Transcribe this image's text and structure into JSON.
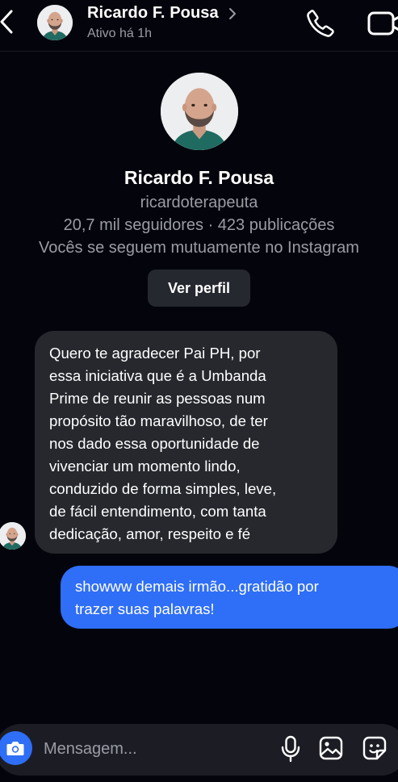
{
  "header": {
    "name": "Ricardo F. Pousa",
    "status": "Ativo há 1h",
    "icons": [
      "back-arrow-icon",
      "chevron-right-icon",
      "phone-icon",
      "video-camera-icon"
    ]
  },
  "profile": {
    "name": "Ricardo F. Pousa",
    "username": "ricardoterapeuta",
    "stats": "20,7 mil seguidores · 423 publicações",
    "mutual": "Vocês se seguem mutuamente no Instagram",
    "view_profile_label": "Ver perfil"
  },
  "messages": [
    {
      "direction": "incoming",
      "text": "Quero te agradecer Pai PH, por\nessa iniciativa que é a Umbanda\nPrime de reunir as pessoas num\npropósito tão maravilhoso, de ter\nnos dado essa oportunidade de\nvivenciar um momento lindo,\nconduzido de forma simples, leve,\nde fácil entendimento, com tanta\ndedicação, amor, respeito e fé"
    },
    {
      "direction": "outgoing",
      "text": "showww demais irmão...gratidão por\ntrazer suas palavras!"
    }
  ],
  "composer": {
    "placeholder": "Mensagem...",
    "icons": [
      "camera-icon",
      "microphone-icon",
      "gallery-icon",
      "sticker-icon"
    ]
  },
  "colors": {
    "background": "#04050c",
    "incoming_bubble": "#26282e",
    "outgoing_bubble": "#2f6ef6",
    "secondary_text": "#9a9ca5"
  }
}
